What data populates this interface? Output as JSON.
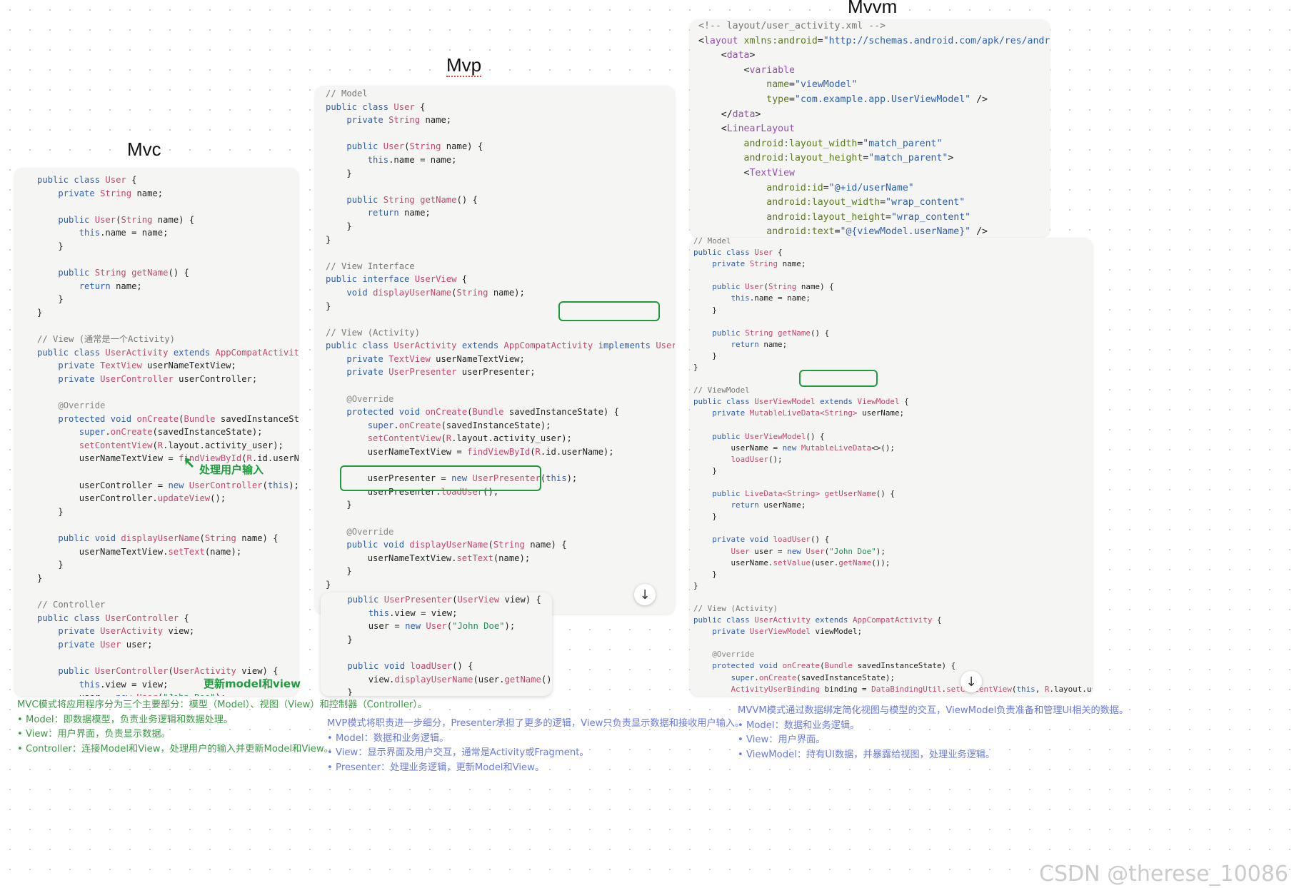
{
  "titles": {
    "mvc": "Mvc",
    "mvp": "Mvp",
    "mvvm": "Mvvm"
  },
  "notes": {
    "mvc_input": "处理用户输入",
    "mvc_update": "更新model和view"
  },
  "descriptions": {
    "mvc": {
      "intro": "MVC模式将应用程序分为三个主要部分：模型（Model）、视图（View）和控制器（Controller）。",
      "items": [
        "Model：即数据模型，负责业务逻辑和数据处理。",
        "View：用户界面，负责显示数据。",
        "Controller：连接Model和View，处理用户的输入并更新Model和View。"
      ]
    },
    "mvp": {
      "intro": "MVP模式将职责进一步细分，Presenter承担了更多的逻辑，View只负责显示数据和接收用户输入。",
      "items": [
        "Model：数据和业务逻辑。",
        "View：显示界面及用户交互，通常是Activity或Fragment。",
        "Presenter：处理业务逻辑，更新Model和View。"
      ]
    },
    "mvvm": {
      "intro": "MVVM模式通过数据绑定简化视图与模型的交互，ViewModel负责准备和管理UI相关的数据。",
      "items": [
        "Model：数据和业务逻辑。",
        "View：用户界面。",
        "ViewModel：持有UI数据，并暴露给视图，处理业务逻辑。"
      ]
    }
  },
  "highlights": {
    "mvp_implements": "implements UserView",
    "mvvm_extends": "extends ViewModel"
  },
  "watermark": "CSDN @therese_10086",
  "icons": {
    "scroll": "arrow-down-icon"
  }
}
